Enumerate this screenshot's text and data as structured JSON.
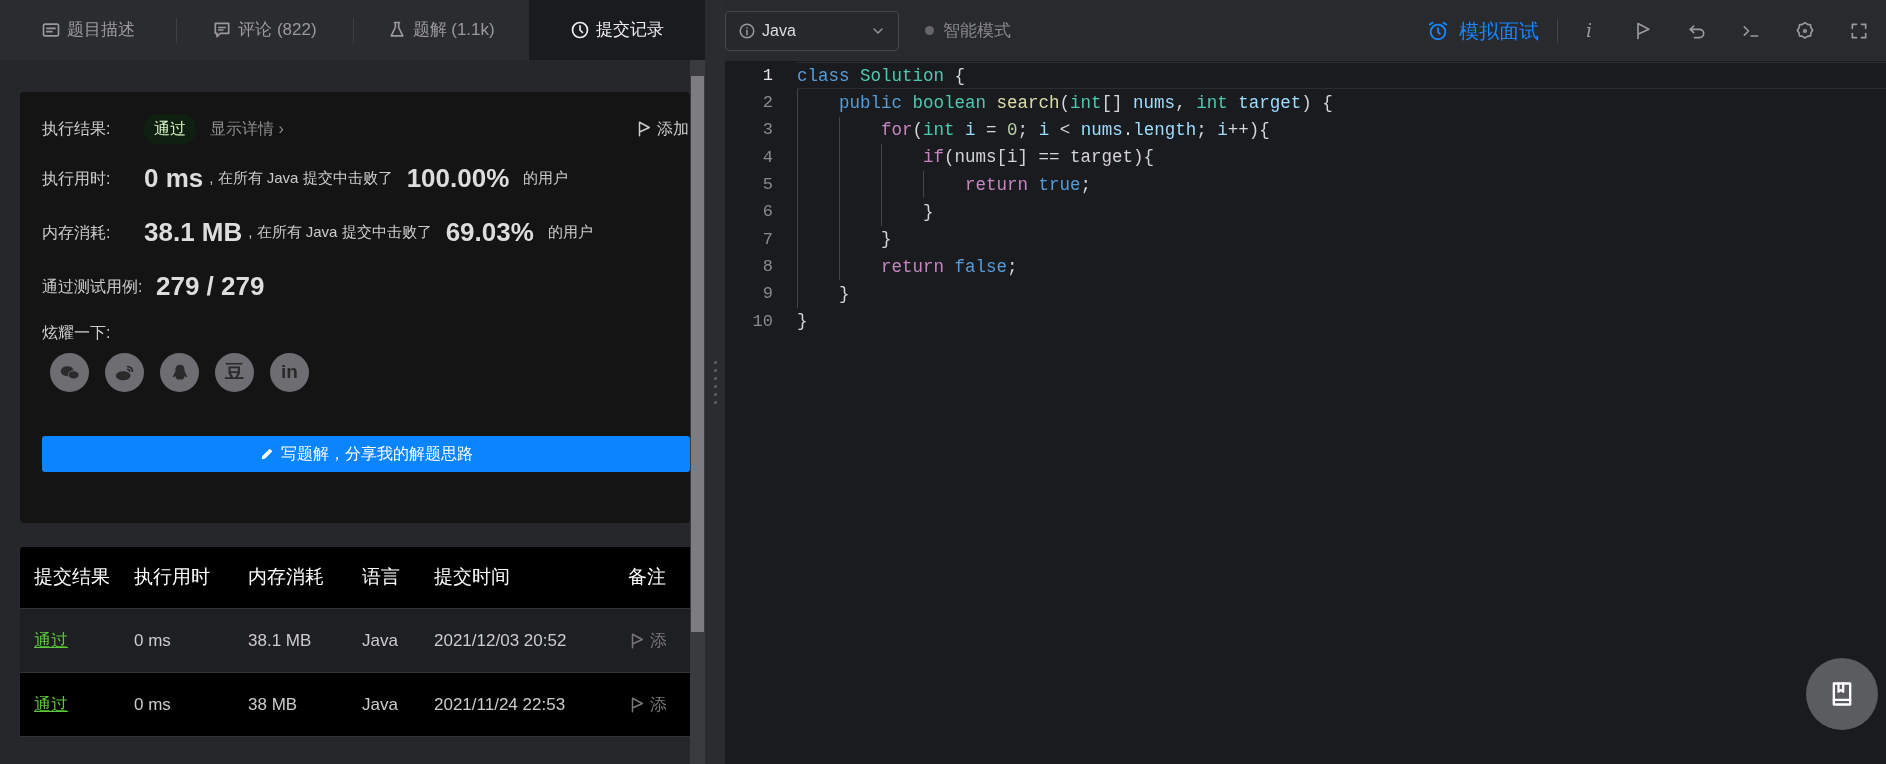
{
  "tabs": [
    {
      "kind": "description",
      "label": "题目描述",
      "selected": false
    },
    {
      "kind": "comments",
      "label": "评论 (822)",
      "selected": false
    },
    {
      "kind": "solutions",
      "label": "题解 (1.1k)",
      "selected": false
    },
    {
      "kind": "submissions",
      "label": "提交记录",
      "selected": true
    }
  ],
  "result": {
    "label": "执行结果:",
    "status": "通过",
    "kind": "passed",
    "details_link": "显示详情 ›",
    "add_note": "添加"
  },
  "metrics": [
    {
      "label": "执行用时:",
      "value": "0 ms",
      "text": ", 在所有 Java 提交中击败了",
      "percent": "100.00%",
      "suffix": "的用户"
    },
    {
      "label": "内存消耗:",
      "value": "38.1 MB",
      "text": ", 在所有 Java 提交中击败了",
      "percent": "69.03%",
      "suffix": "的用户"
    }
  ],
  "test_cases": {
    "label": "通过测试用例:",
    "value": "279 / 279"
  },
  "share": {
    "label": "炫耀一下:",
    "buttons": [
      {
        "kind": "wechat"
      },
      {
        "kind": "weibo"
      },
      {
        "kind": "qq"
      },
      {
        "kind": "text",
        "text": "豆"
      },
      {
        "kind": "text",
        "text": "in"
      }
    ]
  },
  "write_solution_button": "写题解，分享我的解题思路",
  "table": {
    "columns": [
      "提交结果",
      "执行用时",
      "内存消耗",
      "语言",
      "提交时间",
      "备注"
    ],
    "rows": [
      {
        "result": "通过",
        "kind": "passed",
        "time": "0 ms",
        "memory": "38.1 MB",
        "language": "Java",
        "submitted": "2021/12/03 20:52",
        "note": "添"
      },
      {
        "result": "通过",
        "kind": "passed",
        "time": "0 ms",
        "memory": "38 MB",
        "language": "Java",
        "submitted": "2021/11/24 22:53",
        "note": "添"
      }
    ]
  },
  "editor": {
    "language": "Java",
    "smart_mode": {
      "label": "智能模式",
      "on": false
    },
    "mock_interview": "模拟面试",
    "tools": [
      {
        "kind": "info",
        "text": "i"
      },
      {
        "kind": "flag"
      },
      {
        "kind": "undo"
      },
      {
        "kind": "terminal"
      },
      {
        "kind": "settings"
      },
      {
        "kind": "fullscreen"
      }
    ],
    "lines": [
      {
        "number": "1",
        "current": true,
        "tokens": [
          {
            "kind": "kw",
            "text": "class"
          },
          {
            "kind": "type",
            "text": " Solution"
          },
          {
            "kind": "p",
            "text": " {"
          }
        ]
      },
      {
        "number": "2",
        "current": false,
        "tokens": [
          {
            "kind": "kw",
            "text": "    public"
          },
          {
            "kind": "type",
            "text": " boolean"
          },
          {
            "kind": "fn",
            "text": " search"
          },
          {
            "kind": "p",
            "text": "("
          },
          {
            "kind": "type",
            "text": "int"
          },
          {
            "kind": "p",
            "text": "[] "
          },
          {
            "kind": "var",
            "text": "nums"
          },
          {
            "kind": "p",
            "text": ", "
          },
          {
            "kind": "type",
            "text": "int"
          },
          {
            "kind": "var",
            "text": " target"
          },
          {
            "kind": "p",
            "text": ") {"
          }
        ]
      },
      {
        "number": "3",
        "current": false,
        "tokens": [
          {
            "kind": "ctrl",
            "text": "        for"
          },
          {
            "kind": "p",
            "text": "("
          },
          {
            "kind": "type",
            "text": "int"
          },
          {
            "kind": "var",
            "text": " i"
          },
          {
            "kind": "p",
            "text": " = "
          },
          {
            "kind": "num",
            "text": "0"
          },
          {
            "kind": "p",
            "text": "; "
          },
          {
            "kind": "var",
            "text": "i"
          },
          {
            "kind": "p",
            "text": " < "
          },
          {
            "kind": "var",
            "text": "nums"
          },
          {
            "kind": "p",
            "text": "."
          },
          {
            "kind": "var",
            "text": "length"
          },
          {
            "kind": "p",
            "text": "; "
          },
          {
            "kind": "var",
            "text": "i"
          },
          {
            "kind": "p",
            "text": "++){"
          }
        ]
      },
      {
        "number": "4",
        "current": false,
        "tokens": [
          {
            "kind": "ctrl",
            "text": "            if"
          },
          {
            "kind": "p",
            "text": "(nums[i] == target){"
          }
        ]
      },
      {
        "number": "5",
        "current": false,
        "tokens": [
          {
            "kind": "ctrl",
            "text": "                return"
          },
          {
            "kind": "kw",
            "text": " true"
          },
          {
            "kind": "p",
            "text": ";"
          }
        ]
      },
      {
        "number": "6",
        "current": false,
        "tokens": [
          {
            "kind": "p",
            "text": "            }"
          }
        ]
      },
      {
        "number": "7",
        "current": false,
        "tokens": [
          {
            "kind": "p",
            "text": "        }"
          }
        ]
      },
      {
        "number": "8",
        "current": false,
        "tokens": [
          {
            "kind": "ctrl",
            "text": "        return"
          },
          {
            "kind": "kw",
            "text": " false"
          },
          {
            "kind": "p",
            "text": ";"
          }
        ]
      },
      {
        "number": "9",
        "current": false,
        "tokens": [
          {
            "kind": "p",
            "text": "    }"
          }
        ]
      },
      {
        "number": "10",
        "current": false,
        "tokens": [
          {
            "kind": "p",
            "text": "}"
          }
        ]
      }
    ]
  }
}
